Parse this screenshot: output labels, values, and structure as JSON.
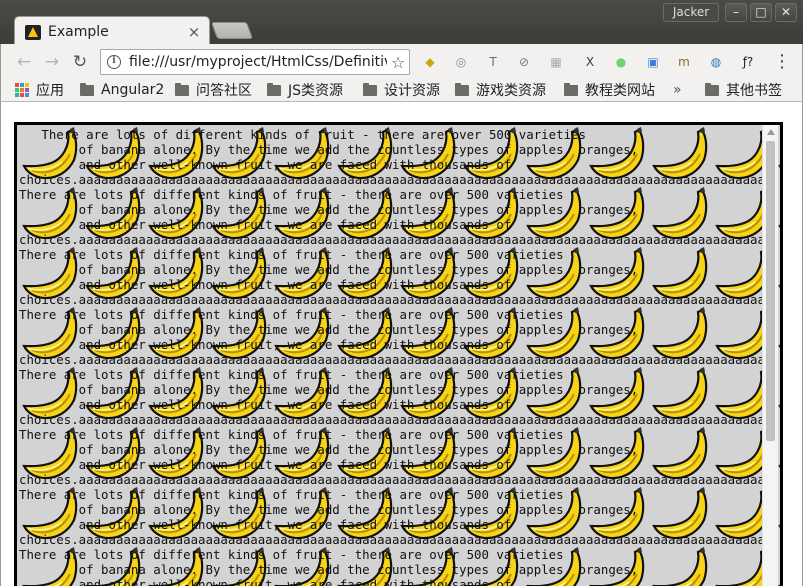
{
  "window": {
    "tab_title": "Example",
    "tab_close": "×",
    "user_name": "Jacker",
    "controls": [
      "–",
      "□",
      "✕"
    ]
  },
  "toolbar": {
    "back": "←",
    "forward": "→",
    "reload": "↻",
    "info": "i",
    "url": "file:///usr/myproject/HtmlCss/Definitive",
    "star": "☆",
    "extensions": [
      {
        "name": "pdf-extension-icon",
        "glyph": "◆",
        "color": "#c9a800"
      },
      {
        "name": "ring-extension-icon",
        "glyph": "◎",
        "color": "#8a8a8a"
      },
      {
        "name": "font-extension-icon",
        "glyph": "T",
        "color": "#6e6e6e"
      },
      {
        "name": "disable-extension-icon",
        "glyph": "⊘",
        "color": "#777"
      },
      {
        "name": "color-grid-extension-icon",
        "glyph": "▦",
        "color": "#aaa"
      },
      {
        "name": "x-extension-icon",
        "glyph": "X",
        "color": "#2c3e50"
      },
      {
        "name": "green-dot-extension-icon",
        "glyph": "●",
        "color": "#6fd36f"
      },
      {
        "name": "bracket-extension-icon",
        "glyph": "▣",
        "color": "#3b7dd8"
      },
      {
        "name": "m-extension-icon",
        "glyph": "m",
        "color": "#8a6d1c"
      },
      {
        "name": "globe-extension-icon",
        "glyph": "◍",
        "color": "#2a7ab8"
      },
      {
        "name": "formula-extension-icon",
        "glyph": "ƒ?",
        "color": "#222"
      }
    ],
    "menu": "⋮"
  },
  "bookmarks": {
    "apps_label": "应用",
    "items": [
      "Angular2",
      "问答社区",
      "JS类资源",
      "设计资源",
      "游戏类资源",
      "教程类网站"
    ],
    "overflow": "»",
    "other_label": "其他书签"
  },
  "content": {
    "paragraphs": [
      "   There are lots of different kinds of fruit - there are over 500 varieties\n        of banana alone. By the time we add the countless types of apples, oranges,\n        and other well-known fruit, we are faced with thousands of\nchoices.aaaaaaaaaaaaaaaaaaaaaaaaaaaaaaaaaaaaaaaaaaaaaaaaaaaaaaaaaaaaaaaaaaaaaaaaaaaaaaaaaaaaaaaaaaaaaaaaaaa",
      "There are lots of different kinds of fruit - there are over 500 varieties\n        of banana alone. By the time we add the countless types of apples, oranges,\n        and other well-known fruit, we are faced with thousands of\nchoices.aaaaaaaaaaaaaaaaaaaaaaaaaaaaaaaaaaaaaaaaaaaaaaaaaaaaaaaaaaaaaaaaaaaaaaaaaaaaaaaaaaaaaaaaaaaaaaaaaaa",
      "There are lots of different kinds of fruit - there are over 500 varieties\n        of banana alone. By the time we add the countless types of apples, oranges,\n        and other well-known fruit, we are faced with thousands of\nchoices.aaaaaaaaaaaaaaaaaaaaaaaaaaaaaaaaaaaaaaaaaaaaaaaaaaaaaaaaaaaaaaaaaaaaaaaaaaaaaaaaaaaaaaaaaaaaaaaaaaa",
      "There are lots of different kinds of fruit - there are over 500 varieties\n        of banana alone. By the time we add the countless types of apples, oranges,\n        and other well-known fruit, we are faced with thousands of\nchoices.aaaaaaaaaaaaaaaaaaaaaaaaaaaaaaaaaaaaaaaaaaaaaaaaaaaaaaaaaaaaaaaaaaaaaaaaaaaaaaaaaaaaaaaaaaaaaaaaaaa",
      "There are lots of different kinds of fruit - there are over 500 varieties\n        of banana alone. By the time we add the countless types of apples, oranges,\n        and other well-known fruit, we are faced with thousands of\nchoices.aaaaaaaaaaaaaaaaaaaaaaaaaaaaaaaaaaaaaaaaaaaaaaaaaaaaaaaaaaaaaaaaaaaaaaaaaaaaaaaaaaaaaaaaaaaaaaaaaaa",
      "There are lots of different kinds of fruit - there are over 500 varieties\n        of banana alone. By the time we add the countless types of apples, oranges,\n        and other well-known fruit, we are faced with thousands of\nchoices.aaaaaaaaaaaaaaaaaaaaaaaaaaaaaaaaaaaaaaaaaaaaaaaaaaaaaaaaaaaaaaaaaaaaaaaaaaaaaaaaaaaaaaaaaaaaaaaaaaa",
      "There are lots of different kinds of fruit - there are over 500 varieties\n        of banana alone. By the time we add the countless types of apples, oranges,\n        and other well-known fruit, we are faced with thousands of\nchoices.aaaaaaaaaaaaaaaaaaaaaaaaaaaaaaaaaaaaaaaaaaaaaaaaaaaaaaaaaaaaaaaaaaaaaaaaaaaaaaaaaaaaaaaaaaaaaaaaaaa",
      "There are lots of different kinds of fruit - there are over 500 varieties\n        of banana alone. By the time we add the countless types of apples, oranges,\n        and other well-known fruit, we are faced with thousands of\nchoices.aaaaaaaaaaaaaaaaaaaaaaaaaaaaaaaaaaaaaaaaaaaaaaaaaaaaaaaaaaaaaaaaaaaaaaaaaaaaaaaaaaaaaaaaaaaaaaaaaaa"
    ]
  }
}
